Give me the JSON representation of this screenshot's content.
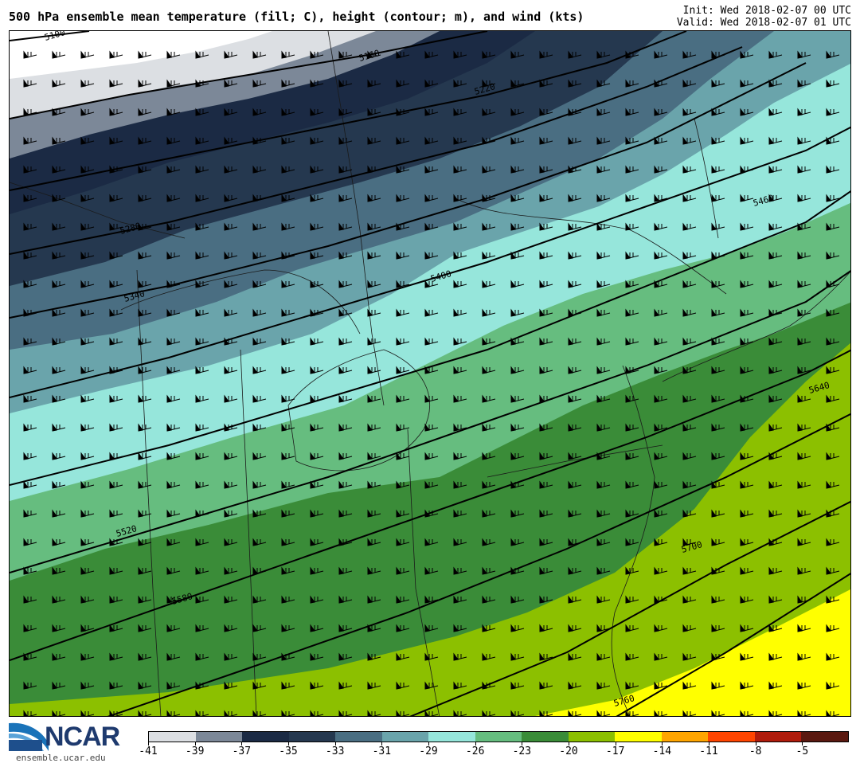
{
  "header": {
    "title": "500 hPa ensemble mean temperature (fill; C), height (contour; m), and wind (kts)",
    "init": "Init: Wed 2018-02-07 00 UTC",
    "valid": "Valid: Wed 2018-02-07 01 UTC"
  },
  "logo": {
    "text": "NCAR",
    "url": "ensemble.ucar.edu"
  },
  "colorbar": {
    "colors": [
      "#dcdfe3",
      "#7c8898",
      "#1b2a44",
      "#25384f",
      "#4a6e82",
      "#6aa4ab",
      "#96e6db",
      "#66bd7f",
      "#3a8c38",
      "#8cc000",
      "#ffff00",
      "#ffa500",
      "#ff4500",
      "#b01c0c",
      "#5a1910"
    ],
    "tick_labels": [
      "-41",
      "-39",
      "-37",
      "-35",
      "-33",
      "-31",
      "-29",
      "-26",
      "-23",
      "-20",
      "-17",
      "-14",
      "-11",
      "-8",
      "-5"
    ]
  },
  "map": {
    "contour_labels": [
      "5100",
      "5160",
      "5220",
      "5280",
      "5340",
      "5400",
      "5460",
      "5520",
      "5580",
      "5640",
      "5700",
      "5760"
    ]
  }
}
